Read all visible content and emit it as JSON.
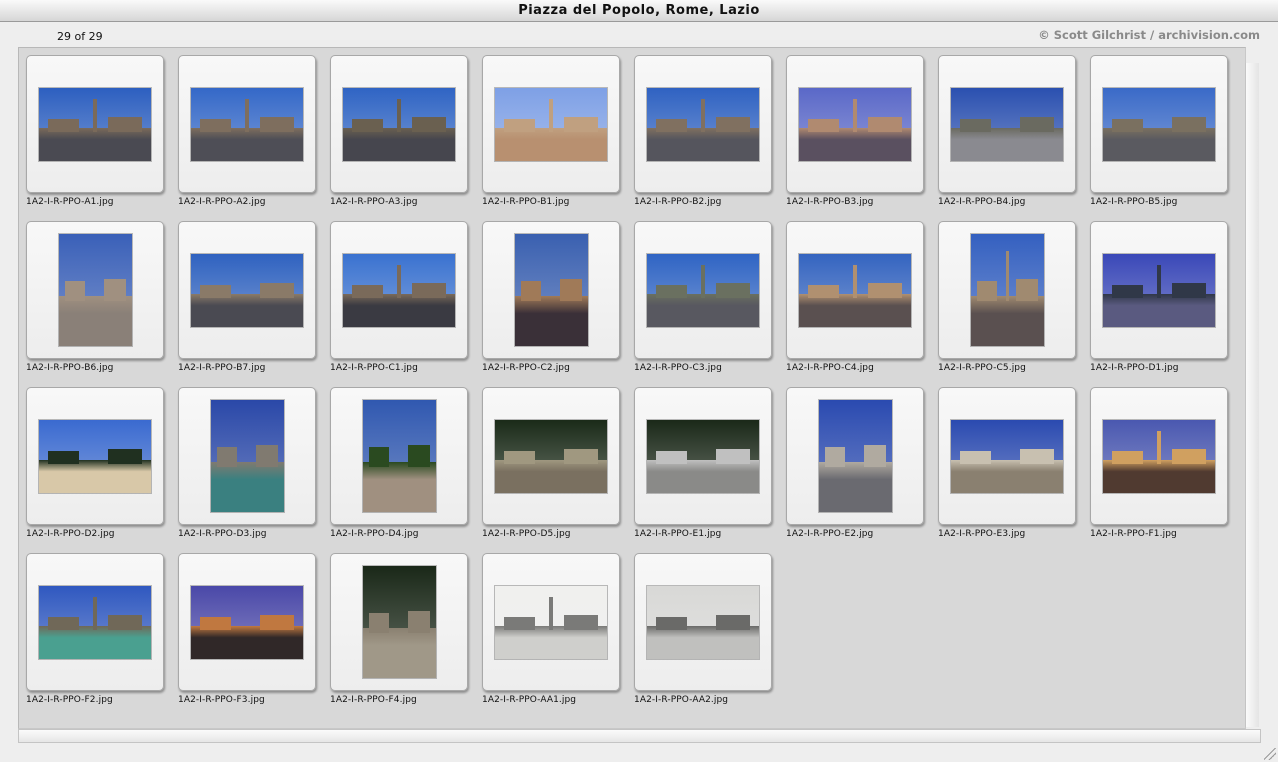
{
  "window": {
    "title": "Piazza del Popolo, Rome, Lazio"
  },
  "header": {
    "count": "29 of 29",
    "copyright": "© Scott Gilchrist / archivision.com"
  },
  "thumbnails": [
    {
      "file": "1A2-I-R-PPO-A1.jpg",
      "orientation": "landscape",
      "sky": "#2c5fc0",
      "ground": "#4a4a52",
      "tint": "#7a6a5a",
      "obelisk": true
    },
    {
      "file": "1A2-I-R-PPO-A2.jpg",
      "orientation": "landscape",
      "sky": "#3468c8",
      "ground": "#4e4e56",
      "tint": "#7e6e5e",
      "obelisk": true
    },
    {
      "file": "1A2-I-R-PPO-A3.jpg",
      "orientation": "landscape",
      "sky": "#2f64c4",
      "ground": "#46464e",
      "tint": "#6a6050",
      "obelisk": true
    },
    {
      "file": "1A2-I-R-PPO-B1.jpg",
      "orientation": "landscape",
      "sky": "#7ea0e6",
      "ground": "#b89070",
      "tint": "#c0a080",
      "obelisk": true
    },
    {
      "file": "1A2-I-R-PPO-B2.jpg",
      "orientation": "landscape",
      "sky": "#2f62c2",
      "ground": "#55555d",
      "tint": "#807060",
      "obelisk": true
    },
    {
      "file": "1A2-I-R-PPO-B3.jpg",
      "orientation": "landscape",
      "sky": "#5a68c8",
      "ground": "#5a5060",
      "tint": "#b08a70",
      "obelisk": true
    },
    {
      "file": "1A2-I-R-PPO-B4.jpg",
      "orientation": "landscape",
      "sky": "#2a50b0",
      "ground": "#8a8a90",
      "tint": "#6a6a60",
      "obelisk": false
    },
    {
      "file": "1A2-I-R-PPO-B5.jpg",
      "orientation": "landscape",
      "sky": "#3a6ac8",
      "ground": "#5a5a60",
      "tint": "#7a7060",
      "obelisk": false
    },
    {
      "file": "1A2-I-R-PPO-B6.jpg",
      "orientation": "portrait",
      "sky": "#3a60b8",
      "ground": "#8a8078",
      "tint": "#a09080",
      "obelisk": false
    },
    {
      "file": "1A2-I-R-PPO-B7.jpg",
      "orientation": "landscape",
      "sky": "#2f62c0",
      "ground": "#4a4a52",
      "tint": "#8a7a68",
      "obelisk": false
    },
    {
      "file": "1A2-I-R-PPO-C1.jpg",
      "orientation": "landscape",
      "sky": "#3a72d0",
      "ground": "#3a3a42",
      "tint": "#7a6a5a",
      "obelisk": true
    },
    {
      "file": "1A2-I-R-PPO-C2.jpg",
      "orientation": "portrait",
      "sky": "#3a60b0",
      "ground": "#3a3038",
      "tint": "#a07a58",
      "obelisk": false
    },
    {
      "file": "1A2-I-R-PPO-C3.jpg",
      "orientation": "landscape",
      "sky": "#2f64c4",
      "ground": "#585860",
      "tint": "#6a7060",
      "obelisk": true
    },
    {
      "file": "1A2-I-R-PPO-C4.jpg",
      "orientation": "landscape",
      "sky": "#3464c0",
      "ground": "#5a5050",
      "tint": "#b09070",
      "obelisk": true
    },
    {
      "file": "1A2-I-R-PPO-C5.jpg",
      "orientation": "portrait",
      "sky": "#3460c0",
      "ground": "#5a5050",
      "tint": "#a08a70",
      "obelisk": true
    },
    {
      "file": "1A2-I-R-PPO-D1.jpg",
      "orientation": "landscape",
      "sky": "#3a48b8",
      "ground": "#5a5a80",
      "tint": "#303848",
      "obelisk": true
    },
    {
      "file": "1A2-I-R-PPO-D2.jpg",
      "orientation": "landscape",
      "sky": "#3a6ad0",
      "ground": "#d8c8a8",
      "tint": "#203020",
      "obelisk": false
    },
    {
      "file": "1A2-I-R-PPO-D3.jpg",
      "orientation": "portrait",
      "sky": "#2a48a8",
      "ground": "#3a8080",
      "tint": "#807a70",
      "obelisk": false
    },
    {
      "file": "1A2-I-R-PPO-D4.jpg",
      "orientation": "portrait",
      "sky": "#3058b0",
      "ground": "#a09080",
      "tint": "#2a4a20",
      "obelisk": false
    },
    {
      "file": "1A2-I-R-PPO-D5.jpg",
      "orientation": "landscape",
      "sky": "#1a2a18",
      "ground": "#7a7060",
      "tint": "#a09880",
      "obelisk": false
    },
    {
      "file": "1A2-I-R-PPO-E1.jpg",
      "orientation": "landscape",
      "sky": "#1a2818",
      "ground": "#8a8a88",
      "tint": "#c0c0c0",
      "obelisk": false
    },
    {
      "file": "1A2-I-R-PPO-E2.jpg",
      "orientation": "portrait",
      "sky": "#2a4ab0",
      "ground": "#6a6a70",
      "tint": "#b0aaa0",
      "obelisk": false
    },
    {
      "file": "1A2-I-R-PPO-E3.jpg",
      "orientation": "landscape",
      "sky": "#2a4ab0",
      "ground": "#8a8070",
      "tint": "#c8c0b0",
      "obelisk": false
    },
    {
      "file": "1A2-I-R-PPO-F1.jpg",
      "orientation": "landscape",
      "sky": "#4a58b0",
      "ground": "#503a30",
      "tint": "#d0a060",
      "obelisk": true
    },
    {
      "file": "1A2-I-R-PPO-F2.jpg",
      "orientation": "landscape",
      "sky": "#2f58c0",
      "ground": "#4aa090",
      "tint": "#706858",
      "obelisk": true
    },
    {
      "file": "1A2-I-R-PPO-F3.jpg",
      "orientation": "landscape",
      "sky": "#4a48a8",
      "ground": "#302828",
      "tint": "#c07840",
      "obelisk": false
    },
    {
      "file": "1A2-I-R-PPO-F4.jpg",
      "orientation": "portrait",
      "sky": "#1a2818",
      "ground": "#a09888",
      "tint": "#8a8070",
      "obelisk": false
    },
    {
      "file": "1A2-I-R-PPO-AA1.jpg",
      "orientation": "landscape",
      "sky": "#f0f0ee",
      "ground": "#cfcfcc",
      "tint": "#7a7a78",
      "obelisk": true
    },
    {
      "file": "1A2-I-R-PPO-AA2.jpg",
      "orientation": "landscape",
      "sky": "#d8d8d6",
      "ground": "#c0c0be",
      "tint": "#6a6a68",
      "obelisk": false
    }
  ]
}
